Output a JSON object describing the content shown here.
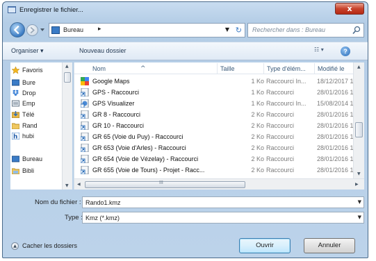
{
  "window": {
    "title": "Enregistrer le fichier...",
    "close_glyph": "x"
  },
  "navigation": {
    "location": "Bureau",
    "separator": "▸",
    "search_placeholder": "Rechercher dans : Bureau"
  },
  "toolbar": {
    "organise_label": "Organiser ▾",
    "new_folder_label": "Nouveau dossier",
    "view_glyph": "☷ ▾",
    "help_glyph": "?"
  },
  "sidebar": {
    "items": [
      {
        "label": "Favoris",
        "icon": "star-icon"
      },
      {
        "label": "Bure",
        "icon": "desktop-icon"
      },
      {
        "label": "Drop",
        "icon": "dropbox-icon"
      },
      {
        "label": "Emp",
        "icon": "recent-places-icon"
      },
      {
        "label": "Télé",
        "icon": "downloads-icon"
      },
      {
        "label": "Rand",
        "icon": "folder-icon"
      },
      {
        "label": "hubi",
        "icon": "hubic-icon"
      },
      {
        "label": "Bureau",
        "icon": "desktop-icon"
      },
      {
        "label": "Bibli",
        "icon": "library-icon"
      }
    ]
  },
  "file_list": {
    "columns": {
      "name": "Nom",
      "size": "Taille",
      "type": "Type d'élém...",
      "modified": "Modifié le"
    },
    "rows": [
      {
        "name": "Google Maps",
        "size": "1 Ko",
        "type": "Raccourci In...",
        "modified": "18/12/2017 1",
        "icon": "google-maps-icon"
      },
      {
        "name": "GPS - Raccourci",
        "size": "1 Ko",
        "type": "Raccourci",
        "modified": "28/01/2016 1",
        "icon": "shortcut-icon"
      },
      {
        "name": "GPS Visualizer",
        "size": "1 Ko",
        "type": "Raccourci In...",
        "modified": "15/08/2014 1",
        "icon": "internet-shortcut-icon"
      },
      {
        "name": "GR 8 - Raccourci",
        "size": "2 Ko",
        "type": "Raccourci",
        "modified": "28/01/2016 1",
        "icon": "shortcut-icon"
      },
      {
        "name": "GR 10 - Raccourci",
        "size": "2 Ko",
        "type": "Raccourci",
        "modified": "28/01/2016 1",
        "icon": "shortcut-icon"
      },
      {
        "name": "GR 65 (Voie du Puy) - Raccourci",
        "size": "2 Ko",
        "type": "Raccourci",
        "modified": "28/01/2016 1",
        "icon": "shortcut-icon"
      },
      {
        "name": "GR 653 (Voie d'Arles) - Raccourci",
        "size": "2 Ko",
        "type": "Raccourci",
        "modified": "28/01/2016 1",
        "icon": "shortcut-icon"
      },
      {
        "name": "GR 654 (Voie de Vézelay) - Raccourci",
        "size": "2 Ko",
        "type": "Raccourci",
        "modified": "28/01/2016 1",
        "icon": "shortcut-icon"
      },
      {
        "name": "GR 655 (Voie de Tours) - Projet - Racc...",
        "size": "2 Ko",
        "type": "Raccourci",
        "modified": "28/01/2016 1",
        "icon": "shortcut-icon"
      }
    ],
    "hscroll_grip": "III"
  },
  "form": {
    "filename_label": "Nom du fichier :",
    "filename_value": "Rando1.kmz",
    "type_label": "Type :",
    "type_value": "Kmz (*.kmz)"
  },
  "footer": {
    "toggle_label": "Cacher les dossiers",
    "open_label": "Ouvrir",
    "cancel_label": "Annuler"
  },
  "colors": {
    "frame": "#b4cde6",
    "accent": "#3a7bc6",
    "close": "#c8432c"
  }
}
